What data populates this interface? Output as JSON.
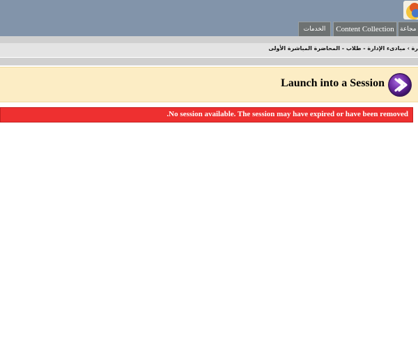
{
  "header": {
    "logo_icon": "app-logo-icon",
    "tabs": [
      {
        "label": "الخدمات"
      },
      {
        "label": "Content Collection"
      },
      {
        "label": "مجاعة"
      }
    ]
  },
  "breadcrumb": {
    "text": "رة › مبادىء الإدارة - طلاب - المحاضرة المباشرة الأولى"
  },
  "launch": {
    "title": "Launch into a Session",
    "button_icon": "arrow-right-circle-icon"
  },
  "error": {
    "message": ".No session available. The session may have expired or have been removed"
  },
  "colors": {
    "header_bg": "#8294aa",
    "tab_bg": "#6e7272",
    "launch_bg": "#fcedc5",
    "error_bg": "#ee3030",
    "launch_icon": "#6a2aa0"
  }
}
